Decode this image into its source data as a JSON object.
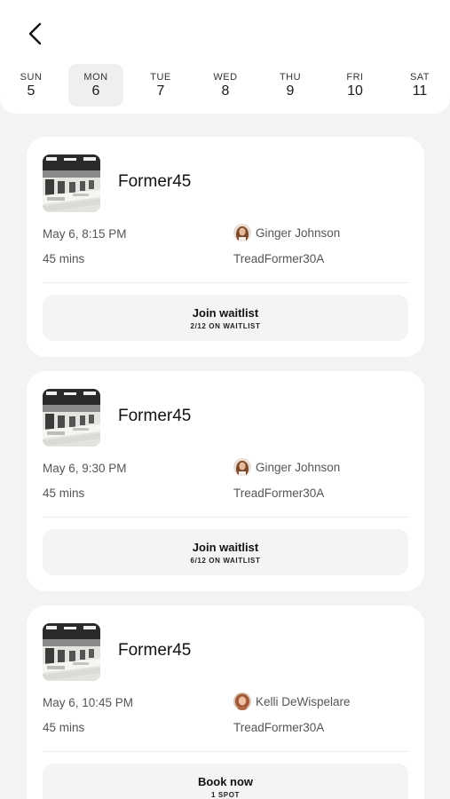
{
  "days": [
    {
      "name": "SUN",
      "num": "5"
    },
    {
      "name": "MON",
      "num": "6"
    },
    {
      "name": "TUE",
      "num": "7"
    },
    {
      "name": "WED",
      "num": "8"
    },
    {
      "name": "THU",
      "num": "9"
    },
    {
      "name": "FRI",
      "num": "10"
    },
    {
      "name": "SAT",
      "num": "11"
    }
  ],
  "selected_day_index": 1,
  "classes": [
    {
      "title": "Former45",
      "datetime": "May 6, 8:15 PM",
      "duration": "45 mins",
      "instructor": "Ginger Johnson",
      "location": "TreadFormer30A",
      "action_label": "Join waitlist",
      "action_sub": "2/12 ON WAITLIST"
    },
    {
      "title": "Former45",
      "datetime": "May 6, 9:30 PM",
      "duration": "45 mins",
      "instructor": "Ginger Johnson",
      "location": "TreadFormer30A",
      "action_label": "Join waitlist",
      "action_sub": "6/12 ON WAITLIST"
    },
    {
      "title": "Former45",
      "datetime": "May 6, 10:45 PM",
      "duration": "45 mins",
      "instructor": "Kelli DeWispelare",
      "location": "TreadFormer30A",
      "action_label": "Book now",
      "action_sub": "1 SPOT"
    }
  ]
}
